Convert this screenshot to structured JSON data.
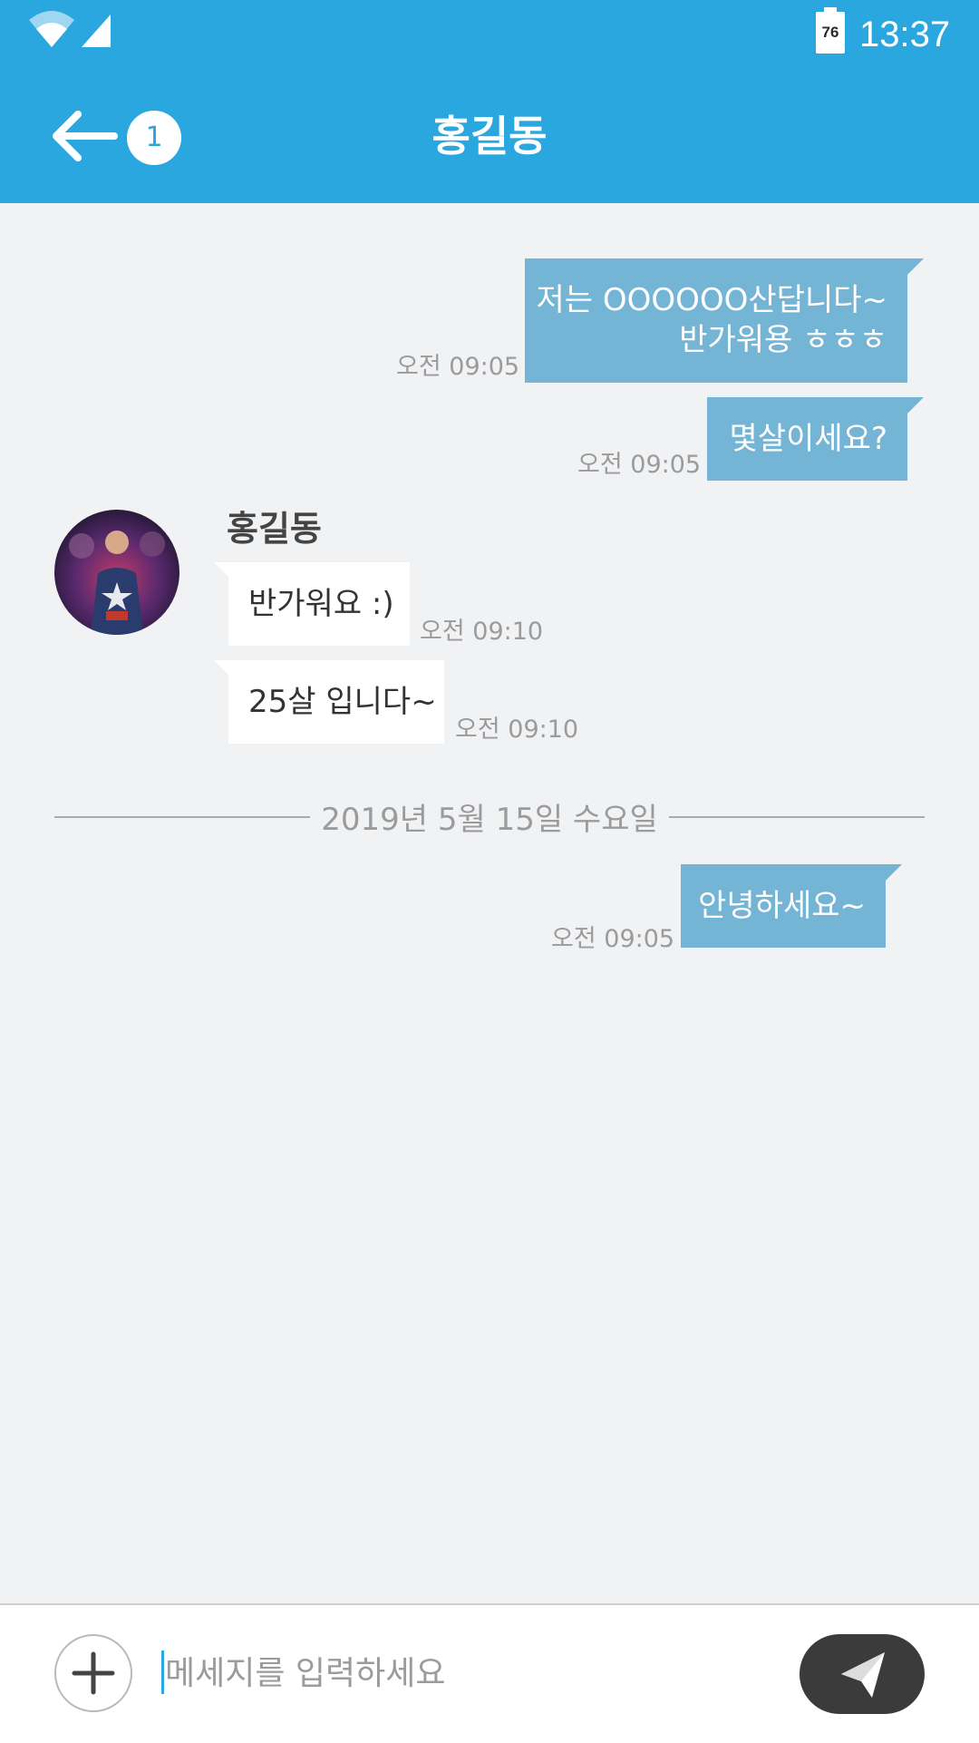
{
  "status_bar": {
    "battery": "76",
    "time": "13:37"
  },
  "header": {
    "title": "홍길동",
    "unread_badge": "1"
  },
  "messages": {
    "m1": {
      "line1": "저는 OOOOOO산답니다~",
      "line2": "반가워용 ㅎㅎㅎ",
      "time": "오전 09:05"
    },
    "m2": {
      "text": "몇살이세요?",
      "time": "오전 09:05"
    },
    "sender_name": "홍길동",
    "m3": {
      "text": "반가워요 :)",
      "time": "오전 09:10"
    },
    "m4": {
      "text": "25살 입니다~",
      "time": "오전 09:10"
    },
    "date_divider": "2019년 5월 15일 수요일",
    "m5": {
      "text": "안녕하세요~",
      "time": "오전 09:05"
    }
  },
  "composer": {
    "placeholder": "메세지를 입력하세요"
  },
  "colors": {
    "header": "#2aa7df",
    "my_bubble": "#74b4d4",
    "their_bubble": "#ffffff",
    "chat_background": "#f1f2f4",
    "send_button": "#3b3b3b"
  },
  "icons": {
    "back": "arrow-left-icon",
    "attach": "plus-icon",
    "send": "paper-plane-icon",
    "wifi": "wifi-icon",
    "signal": "signal-icon",
    "battery": "battery-icon"
  }
}
